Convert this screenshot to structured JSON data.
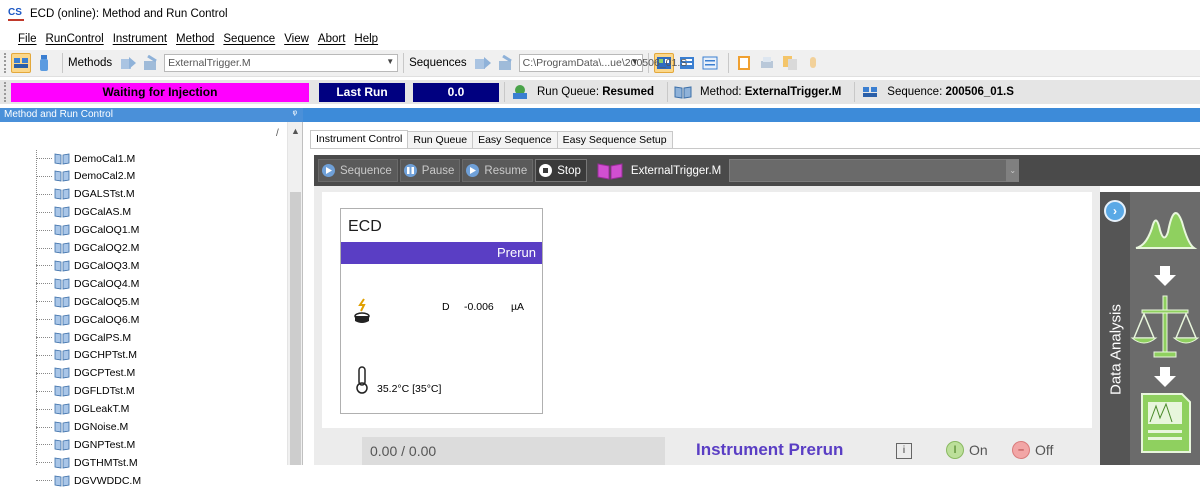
{
  "window": {
    "title": "ECD (online): Method and Run Control",
    "icon_text": "CS"
  },
  "menu": [
    "File",
    "RunControl",
    "Instrument",
    "Method",
    "Sequence",
    "View",
    "Abort",
    "Help"
  ],
  "toolbar": {
    "methods_label": "Methods",
    "method_combo": "ExternalTrigger.M",
    "sequences_label": "Sequences",
    "sequence_path": "C:\\ProgramData\\...ue\\200506_01.S"
  },
  "status": {
    "waiting": "Waiting for Injection",
    "last_run_label": "Last Run",
    "last_run_value": "0.0",
    "run_queue_label": "Run Queue:",
    "run_queue_value": "Resumed",
    "method_label": "Method:",
    "method_value": "ExternalTrigger.M",
    "sequence_label": "Sequence:",
    "sequence_value": "200506_01.S"
  },
  "left_panel": {
    "title": "Method and Run Control",
    "top_marker": "/",
    "methods": [
      "DemoCal1.M",
      "DemoCal2.M",
      "DGALSTst.M",
      "DGCalAS.M",
      "DGCalOQ1.M",
      "DGCalOQ2.M",
      "DGCalOQ3.M",
      "DGCalOQ4.M",
      "DGCalOQ5.M",
      "DGCalOQ6.M",
      "DGCalPS.M",
      "DGCHPTst.M",
      "DGCPTest.M",
      "DGFLDTst.M",
      "DGLeakT.M",
      "DGNoise.M",
      "DGNPTest.M",
      "DGTHMTst.M",
      "DGVWDDC.M"
    ]
  },
  "tabs": [
    "Instrument Control",
    "Run Queue",
    "Easy Sequence",
    "Easy Sequence Setup"
  ],
  "controls": {
    "sequence": "Sequence",
    "pause": "Pause",
    "resume": "Resume",
    "stop": "Stop",
    "method": "ExternalTrigger.M"
  },
  "ecd": {
    "title": "ECD",
    "state": "Prerun",
    "channel": "D",
    "value": "-0.006",
    "unit": "µA",
    "temperature": "35.2°C [35°C]"
  },
  "bottom": {
    "progress": "0.00 / 0.00",
    "instrument_state": "Instrument Prerun",
    "info": "i",
    "on": "On",
    "off": "Off"
  },
  "data_analysis": {
    "label": "Data Analysis"
  },
  "colors": {
    "waiting": "#ff00ff",
    "lastrun": "#000080",
    "prerun": "#5a3ec4",
    "bluestrip": "#3d8bd9"
  }
}
